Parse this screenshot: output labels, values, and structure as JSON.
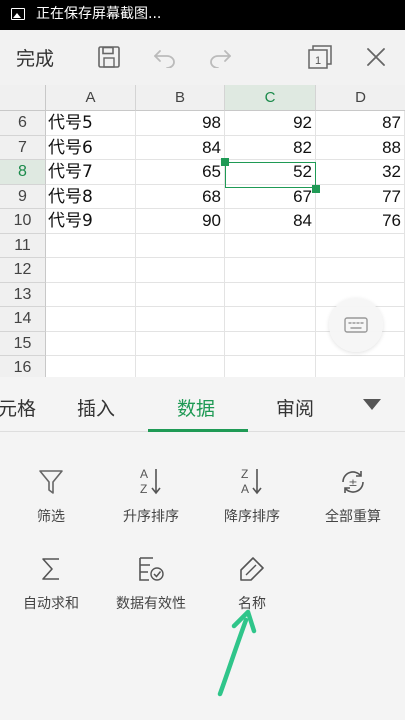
{
  "status_bar": {
    "text": "正在保存屏幕截图..."
  },
  "toolbar": {
    "done_label": "完成"
  },
  "grid": {
    "columns": [
      "A",
      "B",
      "C",
      "D"
    ],
    "selected_column": "C",
    "selected_row": "8",
    "rows": [
      {
        "row": "6",
        "cells": [
          "代号5",
          "98",
          "92",
          "87"
        ]
      },
      {
        "row": "7",
        "cells": [
          "代号6",
          "84",
          "82",
          "88"
        ]
      },
      {
        "row": "8",
        "cells": [
          "代号7",
          "65",
          "52",
          "32"
        ]
      },
      {
        "row": "9",
        "cells": [
          "代号8",
          "68",
          "67",
          "77"
        ]
      },
      {
        "row": "10",
        "cells": [
          "代号9",
          "90",
          "84",
          "76"
        ]
      },
      {
        "row": "11",
        "cells": [
          "",
          "",
          "",
          ""
        ]
      },
      {
        "row": "12",
        "cells": [
          "",
          "",
          "",
          ""
        ]
      },
      {
        "row": "13",
        "cells": [
          "",
          "",
          "",
          ""
        ]
      },
      {
        "row": "14",
        "cells": [
          "",
          "",
          "",
          ""
        ]
      },
      {
        "row": "15",
        "cells": [
          "",
          "",
          "",
          ""
        ]
      },
      {
        "row": "16",
        "cells": [
          "",
          "",
          "",
          ""
        ]
      }
    ]
  },
  "tabs": [
    {
      "label": "元格",
      "active": false
    },
    {
      "label": "插入",
      "active": false
    },
    {
      "label": "数据",
      "active": true
    },
    {
      "label": "审阅",
      "active": false
    }
  ],
  "tools": [
    {
      "label": "筛选",
      "icon": "filter-icon"
    },
    {
      "label": "升序排序",
      "icon": "sort-ascending-icon"
    },
    {
      "label": "降序排序",
      "icon": "sort-descending-icon"
    },
    {
      "label": "全部重算",
      "icon": "recalculate-icon"
    },
    {
      "label": "自动求和",
      "icon": "sum-icon"
    },
    {
      "label": "数据有效性",
      "icon": "data-validation-icon"
    },
    {
      "label": "名称",
      "icon": "name-tag-icon"
    }
  ],
  "colors": {
    "accent": "#1f9a55",
    "arrow": "#2fc58a"
  }
}
